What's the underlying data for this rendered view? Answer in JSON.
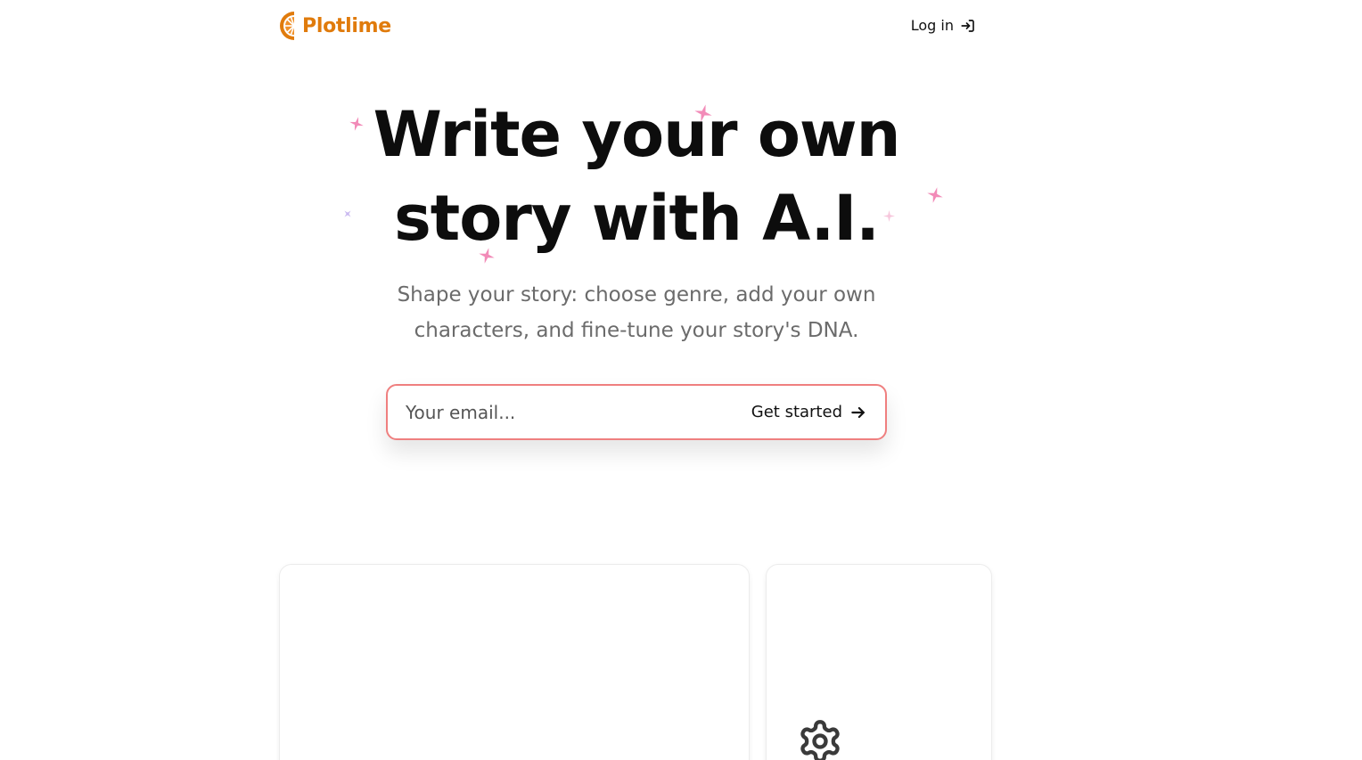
{
  "header": {
    "brand": "Plotlime",
    "brand_color": "#e07b0c",
    "login_label": "Log in",
    "login_icon": "log-in-icon"
  },
  "hero": {
    "title_line1": "Write your own",
    "title_line2": "story with A.I.",
    "subtitle_line1": "Shape your story: choose genre, add your own",
    "subtitle_line2": "characters, and fine-tune your story's DNA.",
    "sparkle_colors": [
      "#f28bb8",
      "#c9b8f0"
    ]
  },
  "signup": {
    "email_placeholder": "Your email...",
    "button_label": "Get started",
    "button_icon": "arrow-right-icon",
    "border_color": "#ef7f7f"
  },
  "features": {
    "card2_icon": "gear-icon"
  }
}
